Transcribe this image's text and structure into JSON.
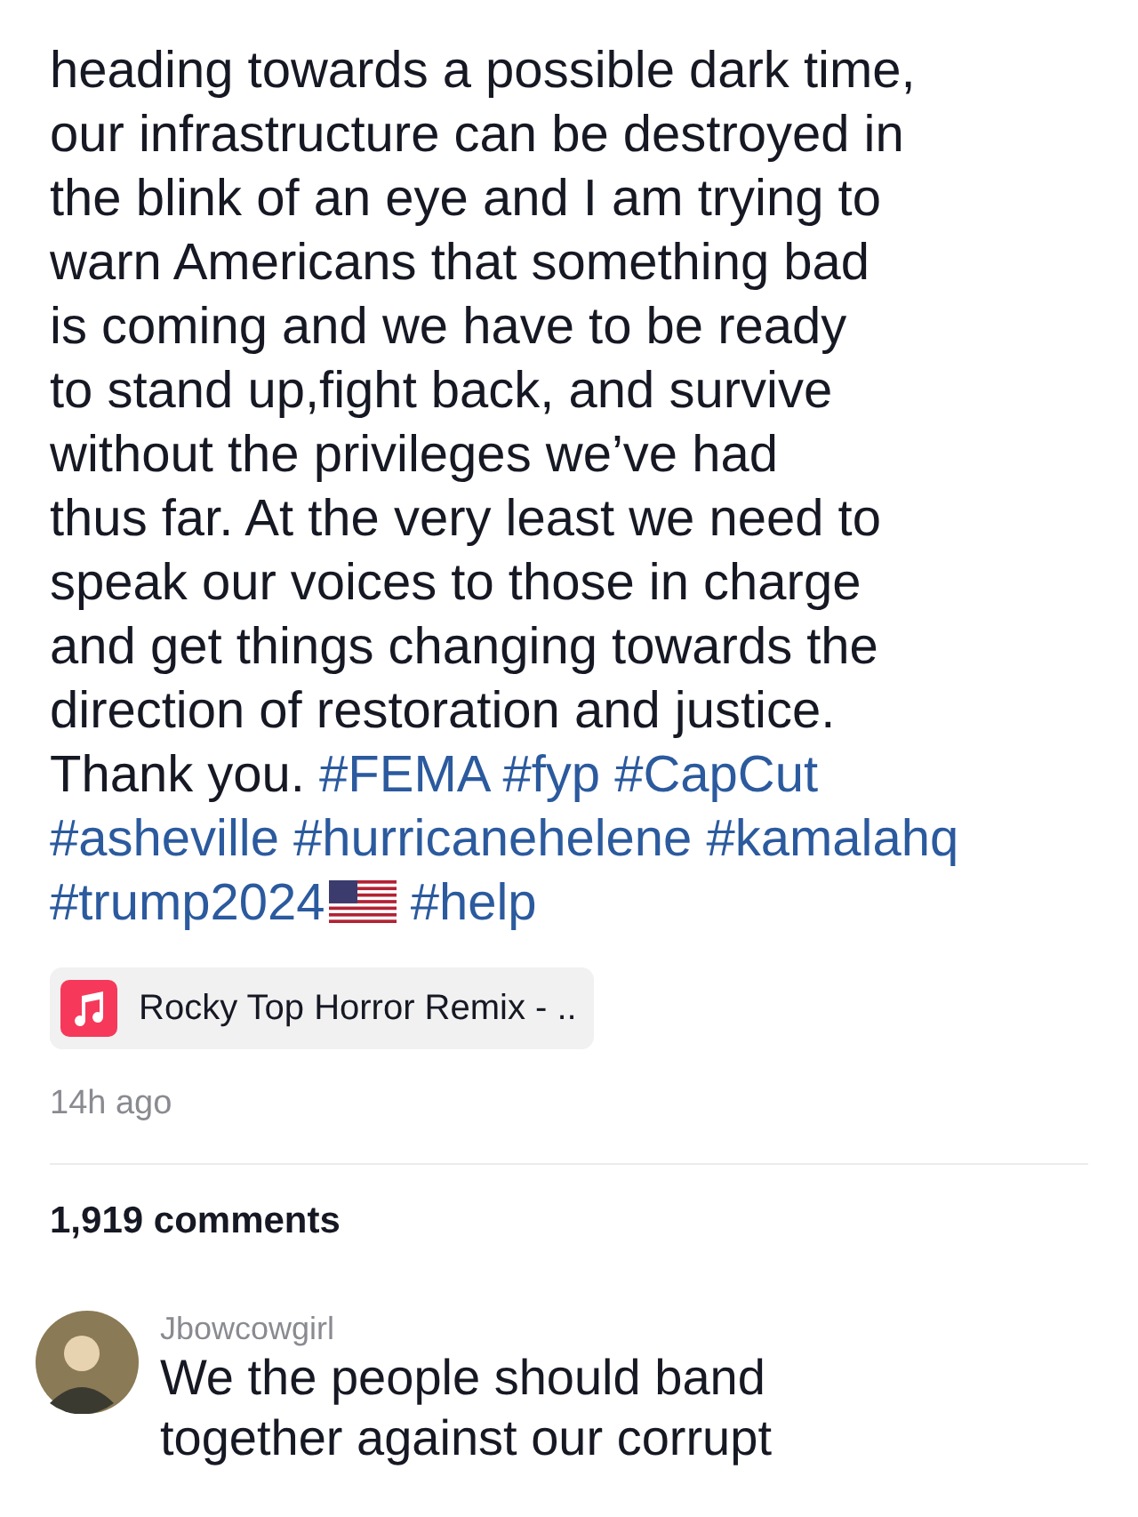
{
  "caption": {
    "lines": [
      {
        "text": "heading towards a possible dark time,"
      },
      {
        "text": "our infrastructure can be destroyed in"
      },
      {
        "text": "the blink of an eye and I am trying to"
      },
      {
        "text": "warn Americans that something bad"
      },
      {
        "text": "is coming and we have to be ready"
      },
      {
        "text": "to stand up,fight back, and survive"
      },
      {
        "text": "without the privileges we’ve had"
      },
      {
        "text": "thus far. At the very least we need to"
      },
      {
        "text": "speak our voices to those in charge"
      },
      {
        "text": "and get things changing towards the"
      },
      {
        "text": "direction of restoration and justice."
      },
      {
        "text": "Thank you.",
        "hashtags": [
          {
            "tag": "#FEMA"
          },
          {
            "tag": "#fyp"
          },
          {
            "tag": "#CapCut"
          }
        ]
      },
      {
        "hashtags": [
          {
            "tag": "#asheville"
          },
          {
            "tag": "#hurricanehelene"
          },
          {
            "tag": "#kamalahq"
          }
        ]
      },
      {
        "hashtags": [
          {
            "tag": "#trump2024",
            "flag": true
          },
          {
            "tag": "#help"
          }
        ]
      }
    ]
  },
  "music": {
    "title": "Rocky Top Horror Remix - .."
  },
  "posted": "14h ago",
  "comments_count": "1,919 comments",
  "comments": [
    {
      "user": "Jbowcowgirl",
      "lines": [
        "We the people should band",
        "together against our corrupt"
      ]
    }
  ]
}
